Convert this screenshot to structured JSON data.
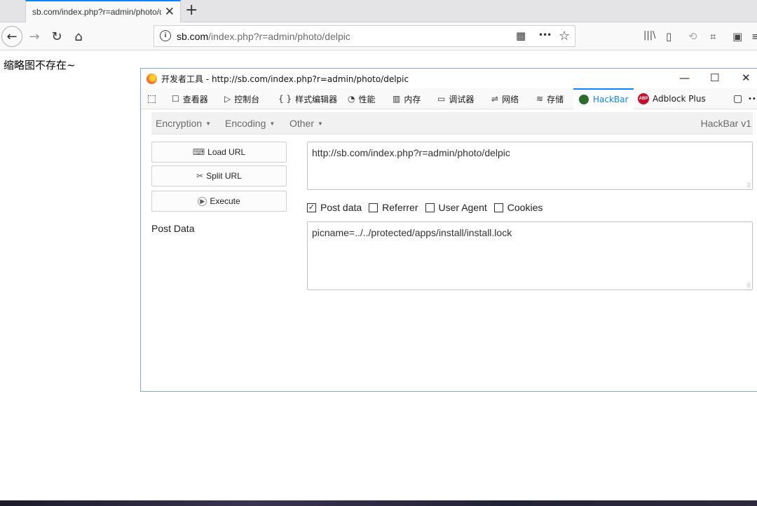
{
  "browser": {
    "tab": {
      "title": "sb.com/index.php?r=admin/photo/delpic",
      "close": "✕"
    },
    "new_tab": "+",
    "url": {
      "host": "sb.com",
      "path": "/index.php?r=admin/photo/delpic"
    },
    "icons": {
      "back": "←",
      "forward": "→",
      "reload": "↻",
      "home": "⌂",
      "qr": "▦",
      "more": "•••",
      "star": "☆",
      "library": "|||\\",
      "sidebar": "▯",
      "sync": "⟲",
      "crop": "⌗",
      "screenshot": "▣",
      "menu": "≡"
    }
  },
  "page": {
    "message": "缩略图不存在~"
  },
  "devtools": {
    "title": "开发者工具 - http://sb.com/index.php?r=admin/photo/delpic",
    "window_controls": {
      "minimize": "—",
      "maximize": "☐",
      "close": "✕"
    },
    "picker_icon": "⬚",
    "tools": [
      {
        "icon": "☐",
        "label": "查看器"
      },
      {
        "icon": "▷",
        "label": "控制台"
      },
      {
        "icon": "{ }",
        "label": "样式编辑器"
      },
      {
        "icon": "◔",
        "label": "性能"
      },
      {
        "icon": "▥",
        "label": "内存"
      },
      {
        "icon": "▭",
        "label": "调试器"
      },
      {
        "icon": "⇌",
        "label": "网络"
      },
      {
        "icon": "≋",
        "label": "存储"
      },
      {
        "label": "HackBar"
      },
      {
        "label": "Adblock Plus"
      }
    ],
    "abp_badge": "ABP",
    "overflow": {
      "dock": "▢",
      "more": "•••"
    },
    "active_tool": "HackBar",
    "accent_color": "#0a84ff"
  },
  "hackbar": {
    "menus": [
      "Encryption",
      "Encoding",
      "Other"
    ],
    "caret": "▼",
    "version": "HackBar v1",
    "buttons": {
      "load_url": "Load URL",
      "split_url": "Split URL",
      "execute": "Execute"
    },
    "button_icons": {
      "load": "⌨",
      "split": "✂",
      "execute": "▶"
    },
    "post_data_label": "Post Data",
    "url_value": "http://sb.com/index.php?r=admin/photo/delpic",
    "checkboxes": [
      {
        "label": "Post data",
        "checked": true,
        "mark": "✓"
      },
      {
        "label": "Referrer",
        "checked": false
      },
      {
        "label": "User Agent",
        "checked": false
      },
      {
        "label": "Cookies",
        "checked": false
      }
    ],
    "post_value": "picname=../../protected/apps/install/install.lock",
    "grip": "⁞⁞"
  }
}
